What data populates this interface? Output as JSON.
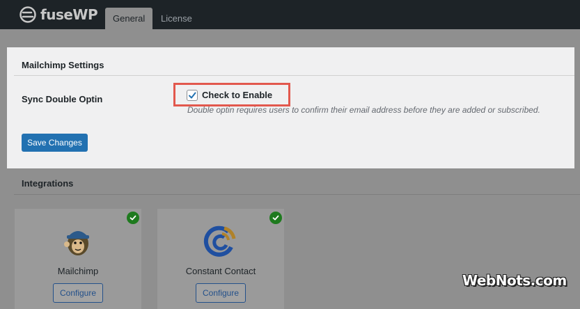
{
  "header": {
    "logo_text": "fuseWP",
    "tabs": [
      {
        "label": "General",
        "active": true
      },
      {
        "label": "License",
        "active": false
      }
    ]
  },
  "settings": {
    "section_title": "Mailchimp Settings",
    "field_label": "Sync Double Optin",
    "checkbox_label": "Check to Enable",
    "checkbox_checked": true,
    "help_text": "Double optin requires users to confirm their email address before they are added or subscribed.",
    "save_label": "Save Changes"
  },
  "integrations": {
    "title": "Integrations",
    "cards": [
      {
        "name": "Mailchimp",
        "button_label": "Configure",
        "connected": true,
        "icon": "mailchimp-logo-icon"
      },
      {
        "name": "Constant Contact",
        "button_label": "Configure",
        "connected": true,
        "icon": "constant-contact-logo-icon"
      }
    ]
  },
  "watermark": "WebNots.com",
  "colors": {
    "header_bg": "#1d2327",
    "primary_button": "#2271b1",
    "highlight_border": "#e2584d",
    "check_badge": "#1e7a1e"
  }
}
